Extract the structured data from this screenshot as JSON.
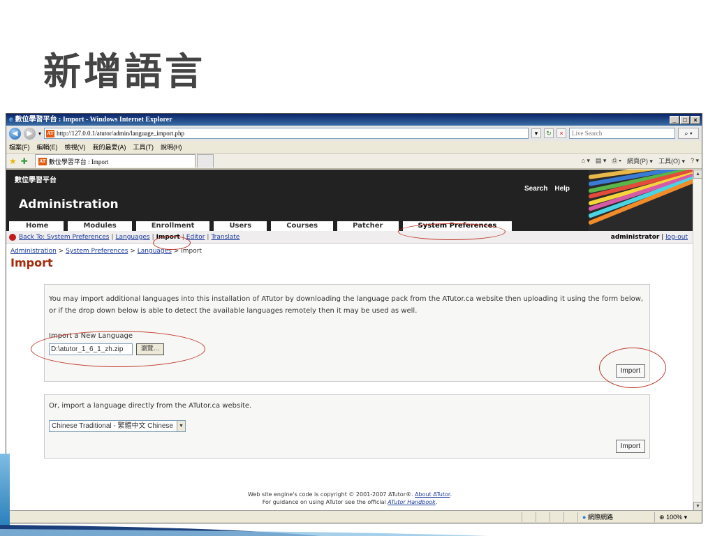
{
  "slide": {
    "title": "新增語言"
  },
  "browser": {
    "window_title": "數位學習平台 : Import - Windows Internet Explorer",
    "address": "http://127.0.0.1/atutor/admin/language_import.php",
    "search_placeholder": "Live Search",
    "menu": [
      "檔案(F)",
      "編輯(E)",
      "檢視(V)",
      "我的最愛(A)",
      "工具(T)",
      "說明(H)"
    ],
    "tab_title": "數位學習平台 : Import",
    "fav_right": [
      "網頁(P) ▾",
      "工具(O) ▾"
    ],
    "status_zone": "網際網路",
    "status_zoom": "100%"
  },
  "site": {
    "name": "數位學習平台",
    "section": "Administration",
    "top_links": {
      "search": "Search",
      "help": "Help"
    },
    "tabs": [
      "Home",
      "Modules",
      "Enrollment",
      "Users",
      "Courses",
      "Patcher",
      "System Preferences"
    ],
    "active_tab": "System Preferences"
  },
  "subnav": {
    "back": "Back To: System Preferences",
    "items": [
      "Languages",
      "Import",
      "Editor",
      "Translate"
    ],
    "current": "Import",
    "user": "administrator",
    "logout": "log-out"
  },
  "breadcrumb": {
    "items": [
      "Administration",
      "System Preferences",
      "Languages"
    ],
    "current": "Import"
  },
  "page_title": "Import",
  "import_box": {
    "intro": "You may import additional languages into this installation of ATutor by downloading the language pack from the ATutor.ca website then uploading it using the form below, or if the drop down below is able to detect the available languages remotely then it may be used as well.",
    "label": "Import a New Language",
    "file_value": "D:\\atutor_1_6_1_zh.zip",
    "browse_label": "瀏覽...",
    "submit": "Import"
  },
  "remote_box": {
    "text": "Or, import a language directly from the ATutor.ca website.",
    "selected": "Chinese Traditional - 繁體中文 Chinese",
    "submit": "Import"
  },
  "footer": {
    "line1_prefix": "Web site engine's code is copyright © 2001-2007 ATutor®.",
    "line1_link": "About ATutor",
    "line2_prefix": "For guidance on using ATutor see the official",
    "line2_link": "ATutor Handbook"
  },
  "colors": {
    "header_bg": "#222222",
    "page_title": "#a52a0a",
    "link": "#1a3a9c",
    "annotation": "#c0392b"
  }
}
